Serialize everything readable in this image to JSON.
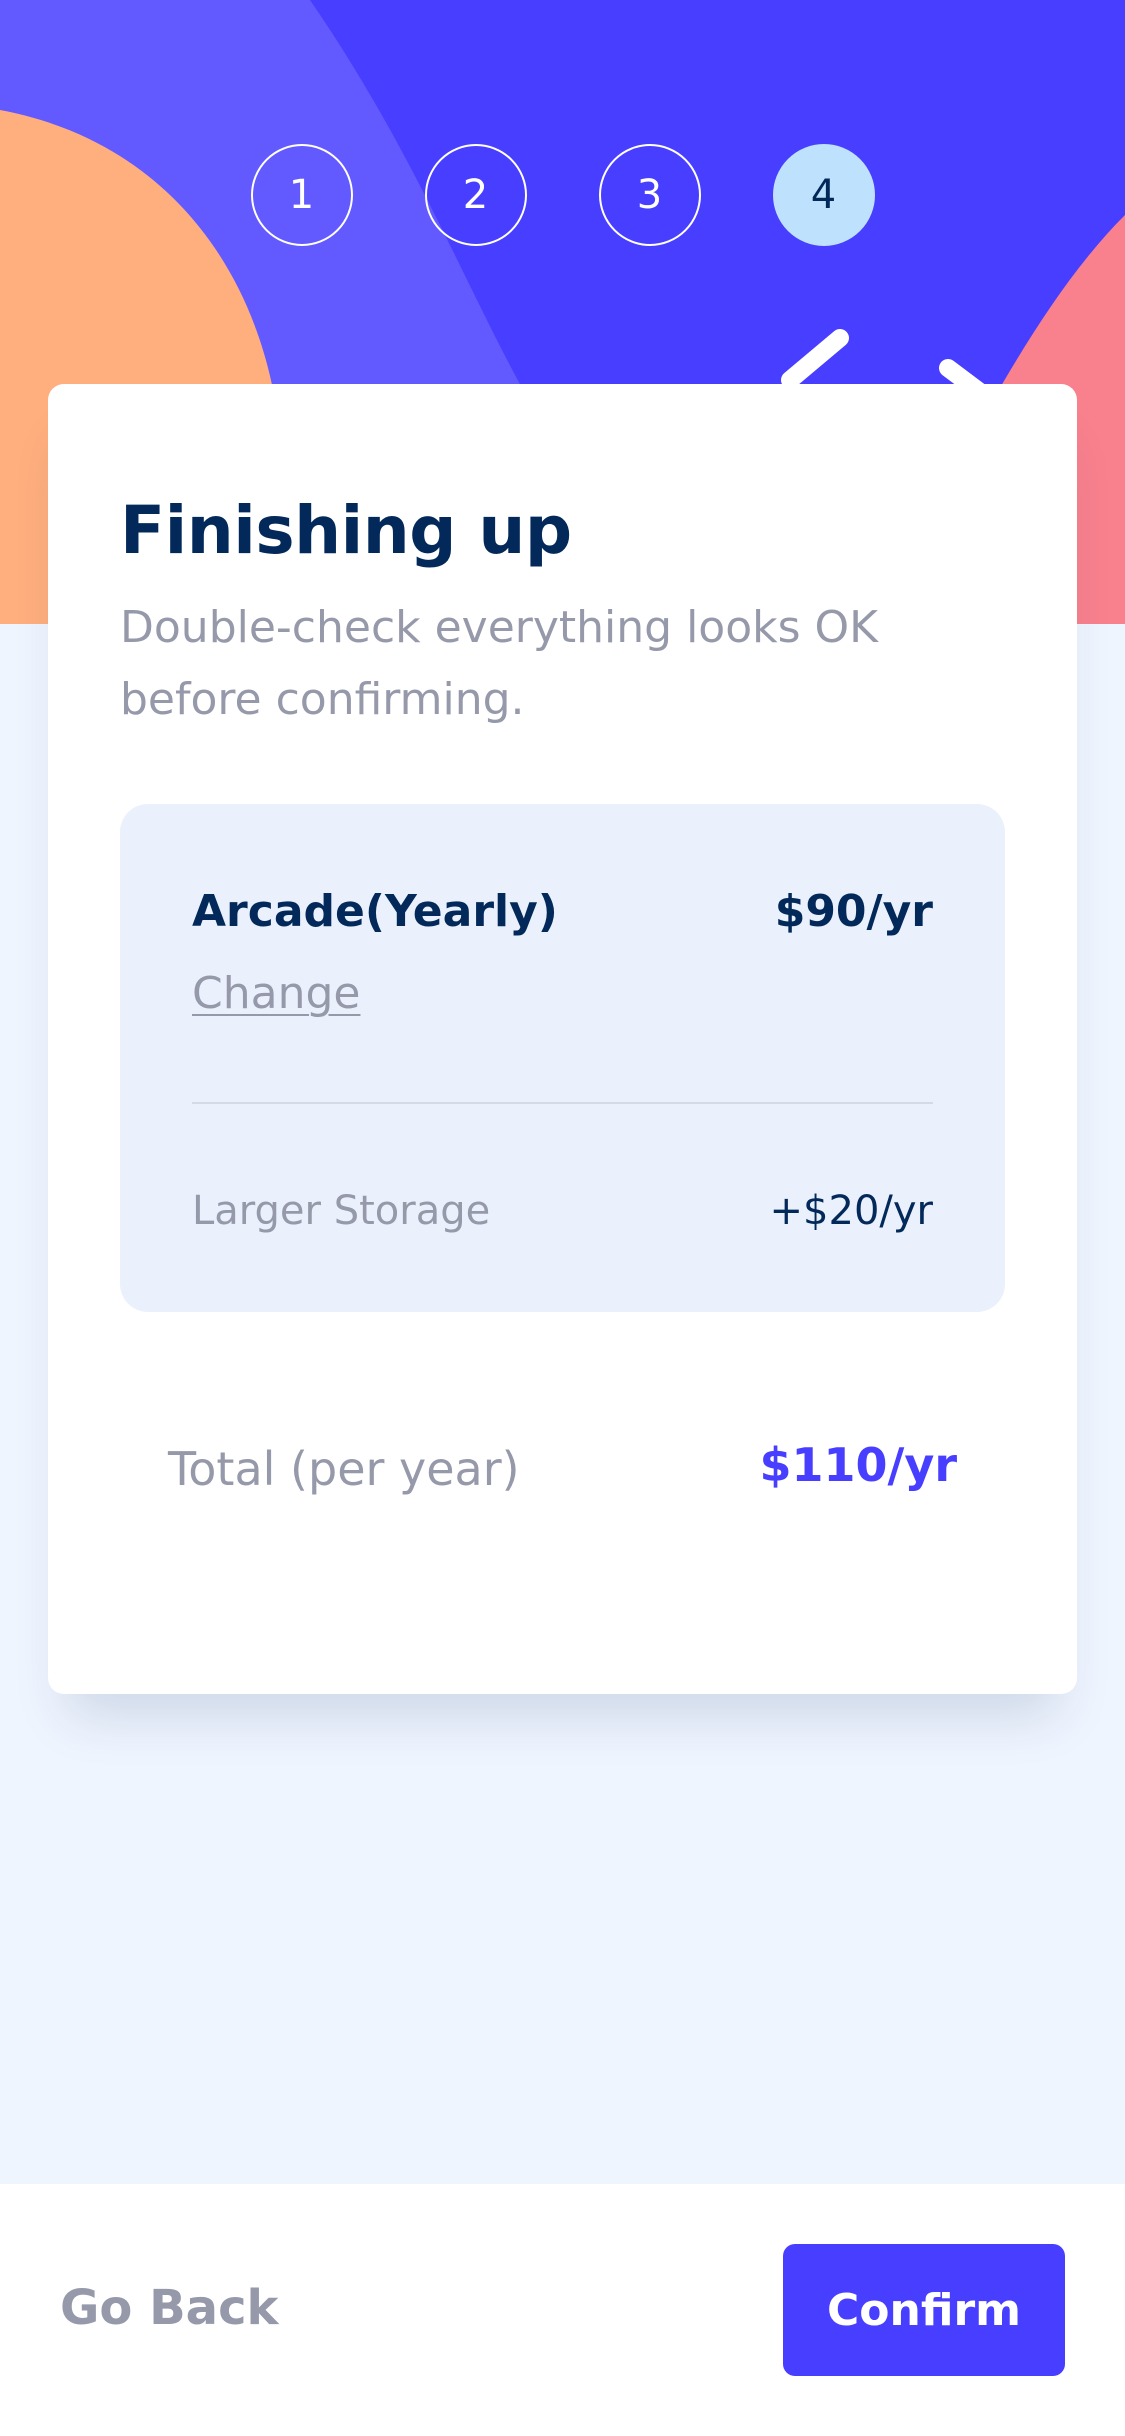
{
  "steps": [
    {
      "number": "1",
      "active": false
    },
    {
      "number": "2",
      "active": false
    },
    {
      "number": "3",
      "active": false
    },
    {
      "number": "4",
      "active": true
    }
  ],
  "card": {
    "title": "Finishing up",
    "subtitle": "Double-check everything looks OK before confirming."
  },
  "summary": {
    "plan_name": "Arcade(Yearly)",
    "plan_price": "$90/yr",
    "change_label": "Change",
    "addon_name": "Larger Storage",
    "addon_price": "+$20/yr"
  },
  "total": {
    "label": "Total (per year)",
    "price": "$110/yr"
  },
  "footer": {
    "back_label": "Go Back",
    "confirm_label": "Confirm"
  },
  "colors": {
    "accent": "#483eff",
    "navy": "#022959",
    "grey": "#9699aa",
    "active_step": "#bee2fd",
    "page_bg": "#eff5ff",
    "hero_orange": "#ffaf7e",
    "hero_pink": "#f9818e"
  }
}
